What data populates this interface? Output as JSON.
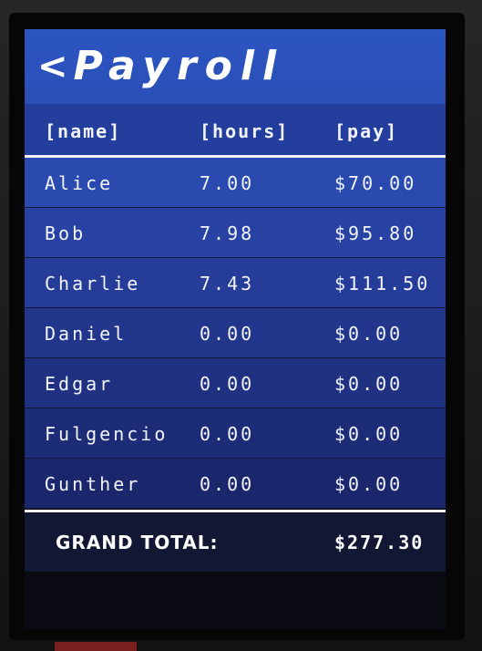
{
  "app": {
    "back_glyph": "<",
    "title": "Payroll"
  },
  "table": {
    "columns": [
      "[name]",
      "[hours]",
      "[pay]"
    ],
    "rows": [
      {
        "name": "Alice",
        "hours": "7.00",
        "pay": "$70.00"
      },
      {
        "name": "Bob",
        "hours": "7.98",
        "pay": "$95.80"
      },
      {
        "name": "Charlie",
        "hours": "7.43",
        "pay": "$111.50"
      },
      {
        "name": "Daniel",
        "hours": "0.00",
        "pay": "$0.00"
      },
      {
        "name": "Edgar",
        "hours": "0.00",
        "pay": "$0.00"
      },
      {
        "name": "Fulgencio",
        "hours": "0.00",
        "pay": "$0.00"
      },
      {
        "name": "Gunther",
        "hours": "0.00",
        "pay": "$0.00"
      }
    ],
    "row_colors": [
      "#2b4ab0",
      "#2842a4",
      "#253c98",
      "#22368c",
      "#203182",
      "#1d2c77",
      "#1b276c"
    ]
  },
  "total": {
    "label": "GRAND TOTAL:",
    "value": "$277.30"
  }
}
